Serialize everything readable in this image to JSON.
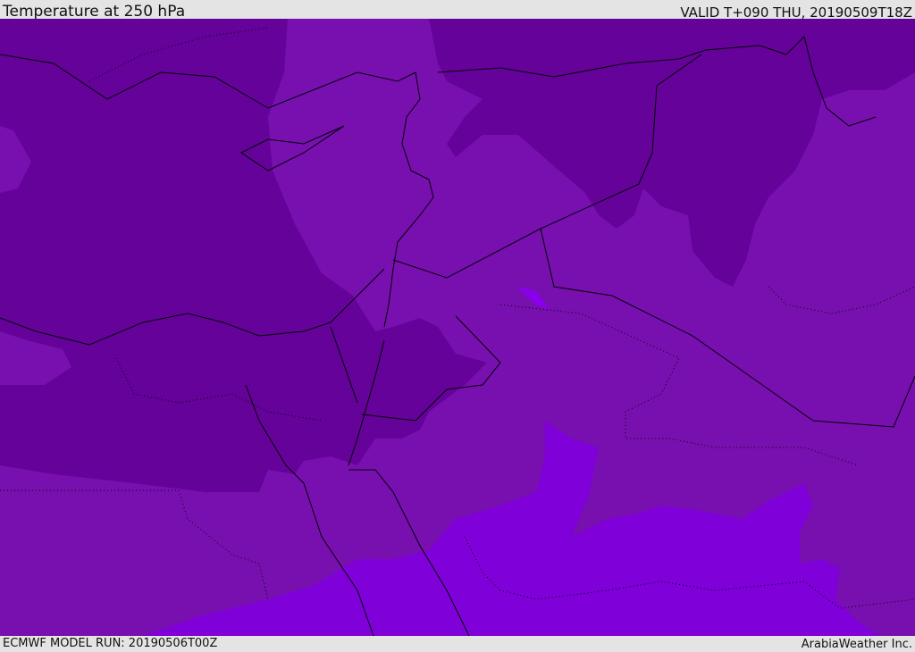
{
  "header": {
    "title": "Temperature at 250 hPa",
    "valid": "VALID T+090 THU, 20190509T18Z"
  },
  "footer": {
    "model_run": "ECMWF MODEL RUN: 20190506T00Z",
    "brand": "ArabiaWeather Inc."
  },
  "map": {
    "fill_colors": {
      "cold": "#65029a",
      "mid": "#7810b0",
      "warm": "#7f00d8"
    }
  }
}
